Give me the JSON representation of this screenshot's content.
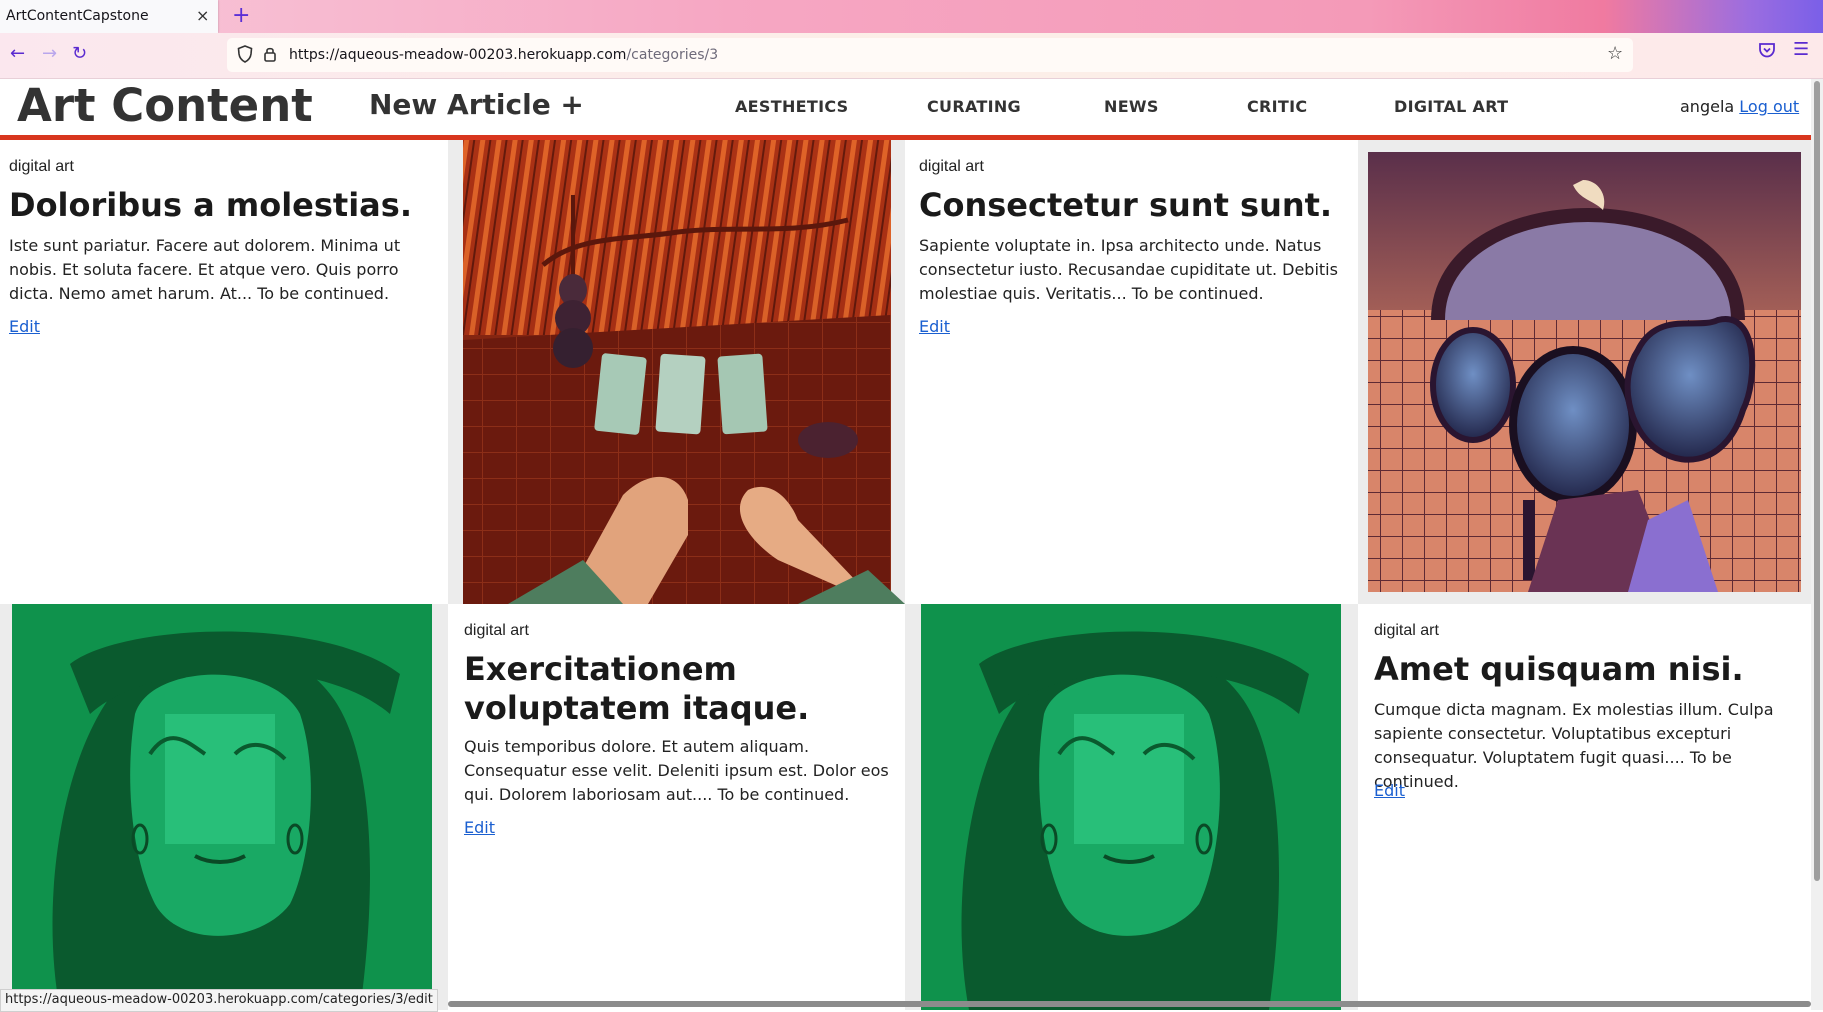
{
  "browser": {
    "tab_title": "ArtContentCapstone",
    "tab_close": "×",
    "new_tab": "+",
    "url_host": "https://aqueous-meadow-00203.herokuapp.com",
    "url_path": "/categories/3",
    "status_url": "https://aqueous-meadow-00203.herokuapp.com/categories/3/edit"
  },
  "site": {
    "logo": "Art Content",
    "new_article": "New Article +",
    "categories": [
      "AESTHETICS",
      "CURATING",
      "NEWS",
      "CRITIC",
      "DIGITAL ART"
    ],
    "username": "angela",
    "logout": "Log out"
  },
  "articles": [
    {
      "category": "digital art",
      "title": "Doloribus a molestias.",
      "body": "Iste sunt pariatur. Facere aut dolorem. Minima ut nobis. Et soluta facere. Et atque vero. Quis porro dicta. Nemo amet harum. At... To be continued.",
      "edit": "Edit"
    },
    {
      "category": "digital art",
      "title": "Consectetur sunt sunt.",
      "body": "Sapiente voluptate in. Ipsa architecto unde. Natus consectetur iusto. Recusandae cupiditate ut. Debitis molestiae quis. Veritatis... To be continued.",
      "edit": "Edit"
    },
    {
      "category": "digital art",
      "title": "Exercitationem voluptatem itaque.",
      "body": "Quis temporibus dolore. Et autem aliquam. Consequatur esse velit. Deleniti ipsum est. Dolor eos qui. Dolorem laboriosam aut.... To be continued.",
      "edit": "Edit"
    },
    {
      "category": "digital art",
      "title": "Amet quisquam nisi.",
      "body": "Cumque dicta magnam. Ex molestias illum. Culpa sapiente consectetur. Voluptatibus excepturi consequatur. Voluptatem fugit quasi.... To be continued.",
      "edit": "Edit"
    }
  ],
  "artwork": {
    "tarot": "painting-tarot-cards-hands",
    "mirrors": "painting-figures-hand-mirrors",
    "green_portrait": "painting-green-portrait-girl"
  }
}
